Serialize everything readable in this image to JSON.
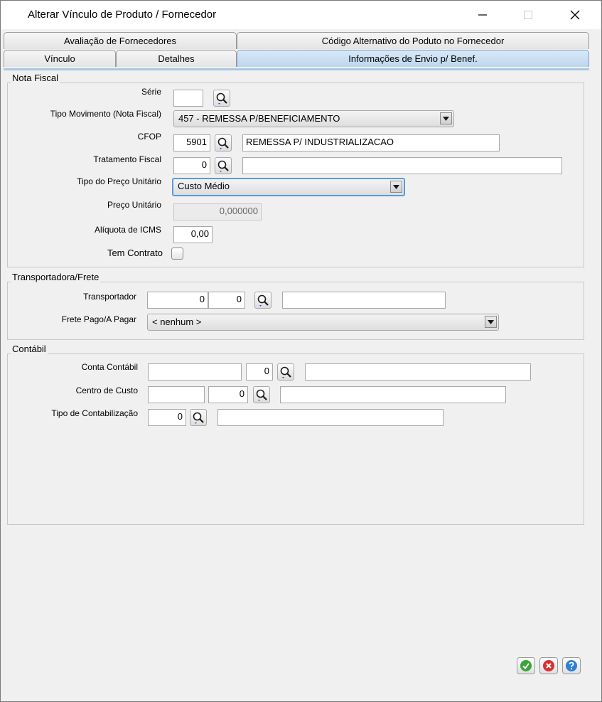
{
  "window": {
    "title": "Alterar Vínculo de Produto / Fornecedor",
    "minimize_icon": "minimize-icon",
    "maximize_icon": "maximize-icon",
    "close_icon": "close-icon"
  },
  "tabs": {
    "row1": [
      {
        "label": "Avaliação de Fornecedores"
      },
      {
        "label": "Código Alternativo do Poduto no Fornecedor"
      }
    ],
    "row2": [
      {
        "label": "Vínculo"
      },
      {
        "label": "Detalhes"
      },
      {
        "label": "Informações de Envio p/ Benef.",
        "active": true
      }
    ]
  },
  "nota_fiscal": {
    "legend": "Nota Fiscal",
    "serie": {
      "label": "Série",
      "value": ""
    },
    "tipo_movimento": {
      "label": "Tipo Movimento (Nota Fiscal)",
      "value": "457 - REMESSA P/BENEFICIAMENTO"
    },
    "cfop": {
      "label": "CFOP",
      "code": "5901",
      "description": "REMESSA P/ INDUSTRIALIZACAO"
    },
    "tratamento_fiscal": {
      "label": "Tratamento Fiscal",
      "code": "0",
      "description": ""
    },
    "tipo_preco": {
      "label": "Tipo do Preço Unitário",
      "value": "Custo Médio"
    },
    "preco_unitario": {
      "label": "Preço Unitário",
      "value": "0,000000"
    },
    "aliquota_icms": {
      "label": "Alíquota de ICMS",
      "value": "0,00"
    },
    "tem_contrato": {
      "label": "Tem Contrato",
      "checked": false
    }
  },
  "transportadora": {
    "legend": "Transportadora/Frete",
    "transportador": {
      "label": "Transportador",
      "code1": "0",
      "code2": "0",
      "name": ""
    },
    "frete": {
      "label": "Frete Pago/A Pagar",
      "value": "< nenhum >"
    }
  },
  "contabil": {
    "legend": "Contábil",
    "conta_contabil": {
      "label": "Conta Contábil",
      "account": "",
      "code": "0",
      "description": ""
    },
    "centro_custo": {
      "label": "Centro de Custo",
      "account": "",
      "code": "0",
      "description": ""
    },
    "tipo_contabilizacao": {
      "label": "Tipo de Contabilização",
      "code": "0",
      "description": ""
    }
  },
  "footer": {
    "buttons": [
      {
        "icon": "confirm-icon",
        "color": "#3aa53a"
      },
      {
        "icon": "cancel-icon",
        "color": "#d93030"
      },
      {
        "icon": "help-icon",
        "color": "#2f7fd6"
      }
    ]
  }
}
